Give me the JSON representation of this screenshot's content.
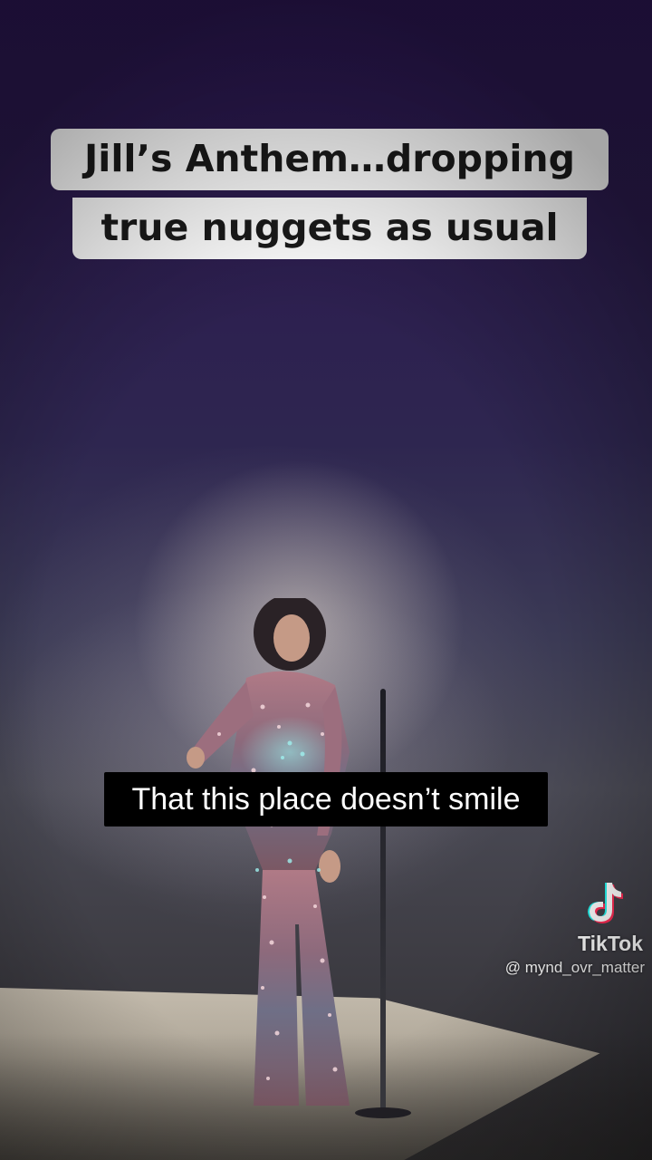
{
  "video": {
    "caption_line1": "Jill’s Anthem…dropping",
    "caption_line2": "true nuggets as usual",
    "subtitle": "That this place doesn’t smile"
  },
  "watermark": {
    "brand": "TikTok",
    "handle": "@ mynd_ovr_matter",
    "icon": "tiktok-note-icon"
  },
  "colors": {
    "caption_bg": "#ffffff",
    "caption_text": "#1a1a1a",
    "subtitle_bg": "#000000",
    "subtitle_text": "#ffffff",
    "tiktok_cyan": "#25f4ee",
    "tiktok_red": "#fe2c55"
  }
}
